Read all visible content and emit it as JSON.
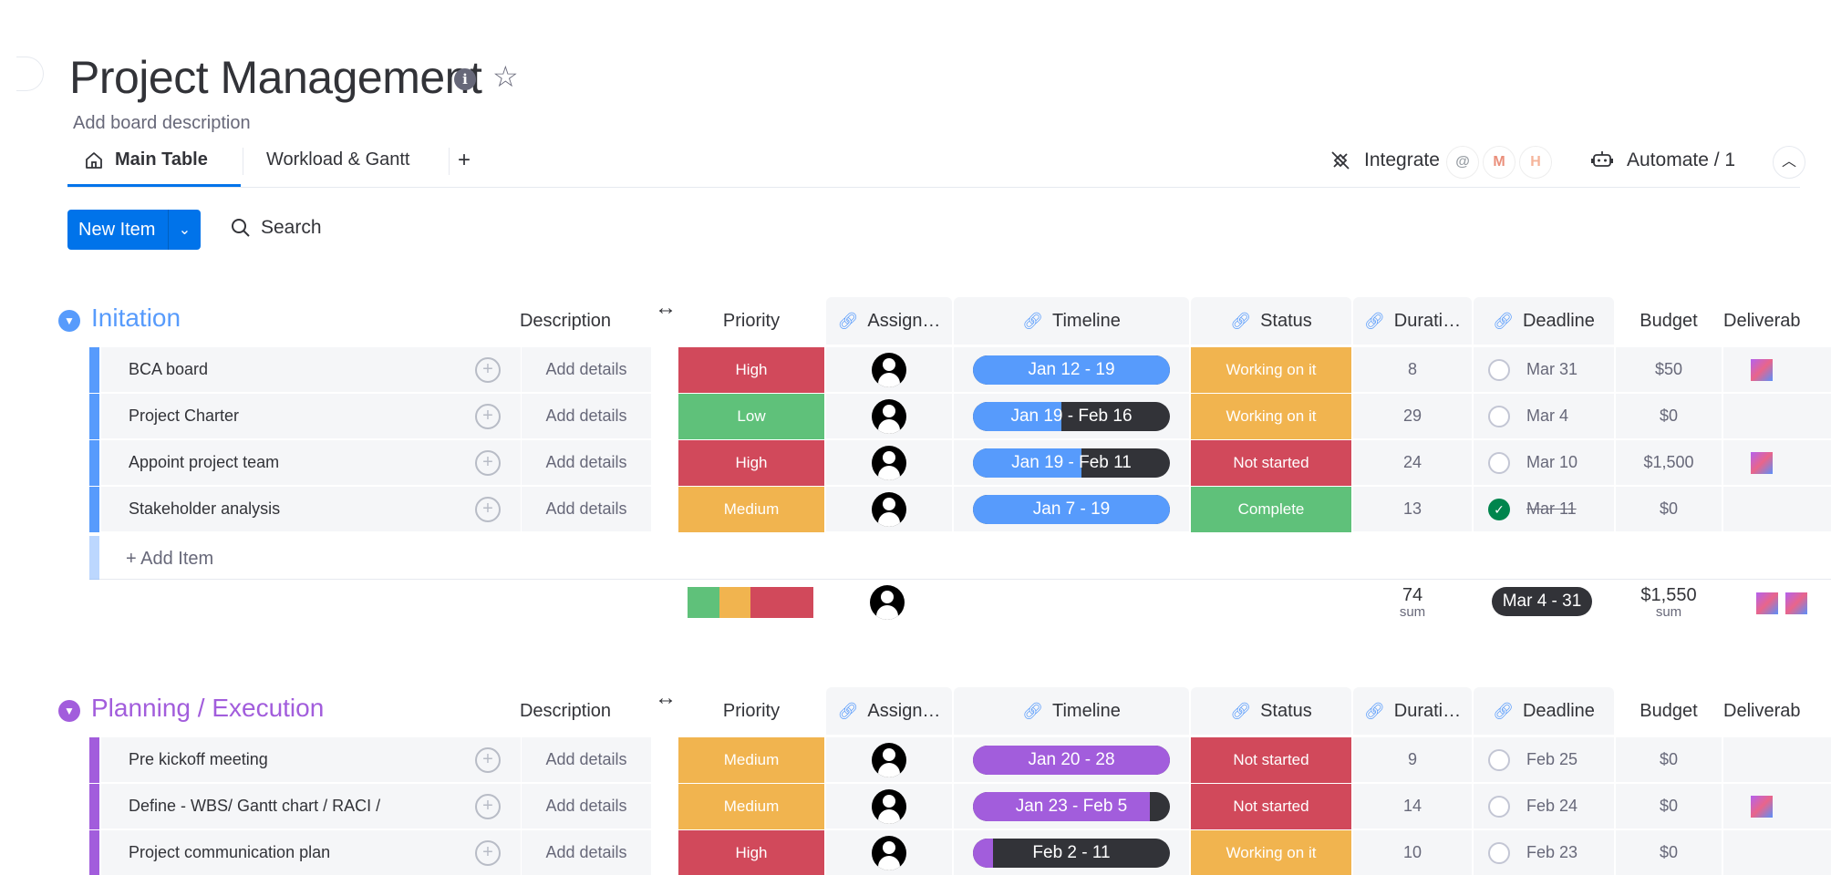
{
  "board": {
    "title": "Project Management",
    "description": "Add board description"
  },
  "tabs": [
    {
      "label": "Main Table",
      "icon": "home-icon",
      "active": true
    },
    {
      "label": "Workload & Gantt",
      "active": false
    }
  ],
  "toolbar": {
    "add_view": "+",
    "integrate_label": "Integrate",
    "integrate_logos": [
      "@",
      "M",
      "H"
    ],
    "automate_label": "Automate / 1",
    "new_item_label": "New Item",
    "search_label": "Search"
  },
  "columns": {
    "description": "Description",
    "priority": "Priority",
    "assignee": "Assign…",
    "timeline": "Timeline",
    "status": "Status",
    "duration": "Durati…",
    "deadline": "Deadline",
    "budget": "Budget",
    "deliverables": "Deliverab"
  },
  "colors": {
    "high": "#e2445c",
    "low": "#00c875",
    "medium": "#fdab3d",
    "working": "#fdab3d",
    "not_started": "#e2445c",
    "complete": "#00c875",
    "group1": "#579bfc",
    "group2": "#a25ddc",
    "timeline_blue": "#579bfc",
    "timeline_purple": "#a25ddc"
  },
  "groups": [
    {
      "title": "Initation",
      "color": "#579bfc",
      "add_item": "+ Add Item",
      "items": [
        {
          "name": "BCA board",
          "description": "Add details",
          "priority": "High",
          "priority_color": "#d1495b",
          "timeline": "Jan 12 - 19",
          "timeline_progress": 1.0,
          "status": "Working on it",
          "status_color": "#f1b44f",
          "duration": "8",
          "deadline": "Mar 31",
          "deadline_done": false,
          "budget": "$50",
          "has_deliverable": true
        },
        {
          "name": "Project Charter",
          "description": "Add details",
          "priority": "Low",
          "priority_color": "#5fc17a",
          "timeline": "Jan 19 - Feb 16",
          "timeline_progress": 0.45,
          "status": "Working on it",
          "status_color": "#f1b44f",
          "duration": "29",
          "deadline": "Mar 4",
          "deadline_done": false,
          "budget": "$0",
          "has_deliverable": false
        },
        {
          "name": "Appoint project team",
          "description": "Add details",
          "priority": "High",
          "priority_color": "#d1495b",
          "timeline": "Jan 19 - Feb 11",
          "timeline_progress": 0.55,
          "status": "Not started",
          "status_color": "#d1495b",
          "duration": "24",
          "deadline": "Mar 10",
          "deadline_done": false,
          "budget": "$1,500",
          "has_deliverable": true
        },
        {
          "name": "Stakeholder analysis",
          "description": "Add details",
          "priority": "Medium",
          "priority_color": "#f1b44f",
          "timeline": "Jan 7 - 19",
          "timeline_progress": 1.0,
          "status": "Complete",
          "status_color": "#5fc17a",
          "duration": "13",
          "deadline": "Mar 11",
          "deadline_done": true,
          "budget": "$0",
          "has_deliverable": false
        }
      ],
      "summary": {
        "duration_total": "74",
        "duration_sub": "sum",
        "deadline_range": "Mar 4 - 31",
        "budget_total": "$1,550",
        "budget_sub": "sum",
        "priority_mix": [
          {
            "color": "#5fc17a",
            "share": 0.25
          },
          {
            "color": "#f1b44f",
            "share": 0.25
          },
          {
            "color": "#d1495b",
            "share": 0.5
          }
        ]
      }
    },
    {
      "title": "Planning / Execution",
      "color": "#a25ddc",
      "items": [
        {
          "name": "Pre kickoff meeting",
          "description": "Add details",
          "priority": "Medium",
          "priority_color": "#f1b44f",
          "timeline": "Jan 20 - 28",
          "timeline_progress": 1.0,
          "status": "Not started",
          "status_color": "#d1495b",
          "duration": "9",
          "deadline": "Feb 25",
          "deadline_done": false,
          "budget": "$0",
          "has_deliverable": false
        },
        {
          "name": "Define - WBS/ Gantt chart / RACI /",
          "description": "Add details",
          "priority": "Medium",
          "priority_color": "#f1b44f",
          "timeline": "Jan 23 - Feb 5",
          "timeline_progress": 0.9,
          "status": "Not started",
          "status_color": "#d1495b",
          "duration": "14",
          "deadline": "Feb 24",
          "deadline_done": false,
          "budget": "$0",
          "has_deliverable": true
        },
        {
          "name": "Project communication plan",
          "description": "Add details",
          "priority": "High",
          "priority_color": "#d1495b",
          "timeline": "Feb 2 - 11",
          "timeline_progress": 0.1,
          "status": "Working on it",
          "status_color": "#f1b44f",
          "duration": "10",
          "deadline": "Feb 23",
          "deadline_done": false,
          "budget": "$0",
          "has_deliverable": false
        }
      ]
    }
  ]
}
